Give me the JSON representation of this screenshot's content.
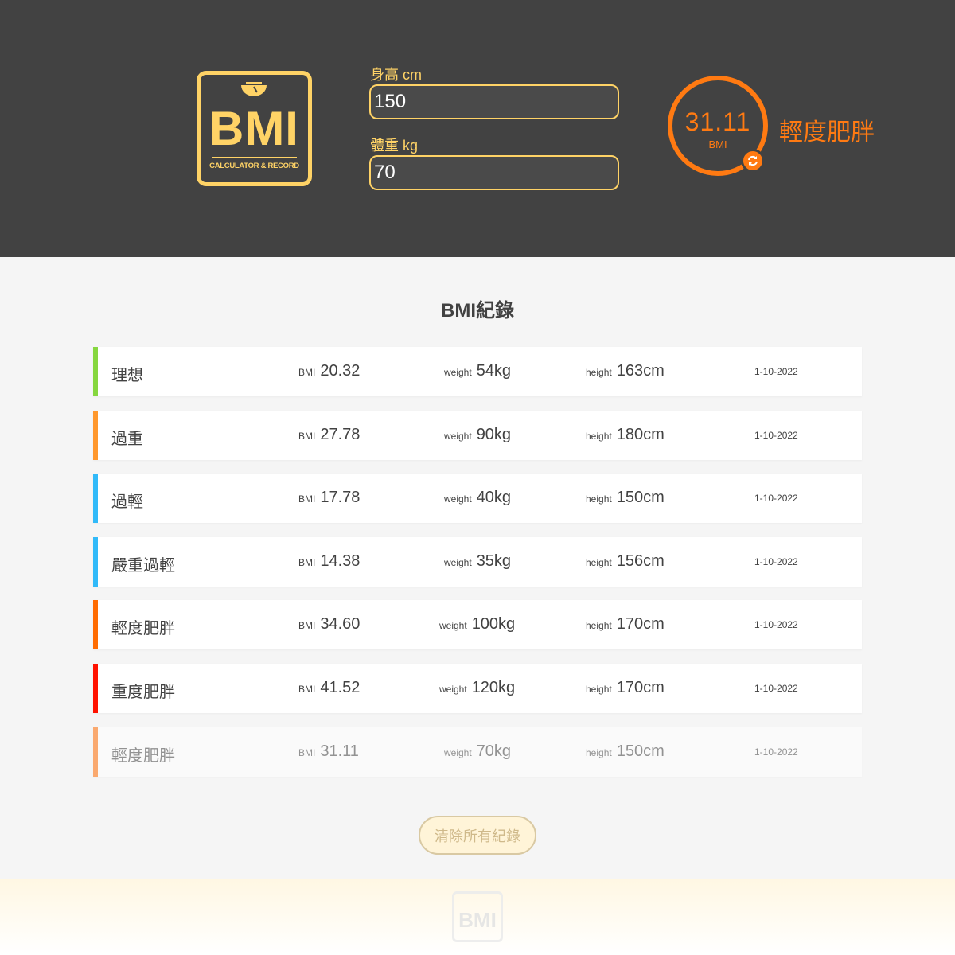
{
  "logo": {
    "title": "BMI",
    "subtitle": "CALCULATOR & RECORD",
    "color": "#ffd366"
  },
  "form": {
    "height_label": "身高 cm",
    "height_value": "150",
    "weight_label": "體重 kg",
    "weight_value": "70"
  },
  "result": {
    "bmi": "31.11",
    "unit": "BMI",
    "status": "輕度肥胖",
    "color": "#ff7a12",
    "reset_icon": "refresh-icon"
  },
  "records_title": "BMI紀錄",
  "labels": {
    "bmi": "BMI",
    "weight": "weight",
    "height": "height"
  },
  "records": [
    {
      "status": "理想",
      "bmi": "20.32",
      "weight": "54kg",
      "height": "163cm",
      "date": "1-10-2022",
      "color": "#86d73f"
    },
    {
      "status": "過重",
      "bmi": "27.78",
      "weight": "90kg",
      "height": "180cm",
      "date": "1-10-2022",
      "color": "#ff982d"
    },
    {
      "status": "過輕",
      "bmi": "17.78",
      "weight": "40kg",
      "height": "150cm",
      "date": "1-10-2022",
      "color": "#31baf9"
    },
    {
      "status": "嚴重過輕",
      "bmi": "14.38",
      "weight": "35kg",
      "height": "156cm",
      "date": "1-10-2022",
      "color": "#31baf9"
    },
    {
      "status": "輕度肥胖",
      "bmi": "34.60",
      "weight": "100kg",
      "height": "170cm",
      "date": "1-10-2022",
      "color": "#ff6c02"
    },
    {
      "status": "重度肥胖",
      "bmi": "41.52",
      "weight": "120kg",
      "height": "170cm",
      "date": "1-10-2022",
      "color": "#ff1200"
    },
    {
      "status": "輕度肥胖",
      "bmi": "31.11",
      "weight": "70kg",
      "height": "150cm",
      "date": "1-10-2022",
      "color": "#ff6c02"
    }
  ],
  "clear_button": "清除所有紀錄",
  "footer_logo": "BMI"
}
